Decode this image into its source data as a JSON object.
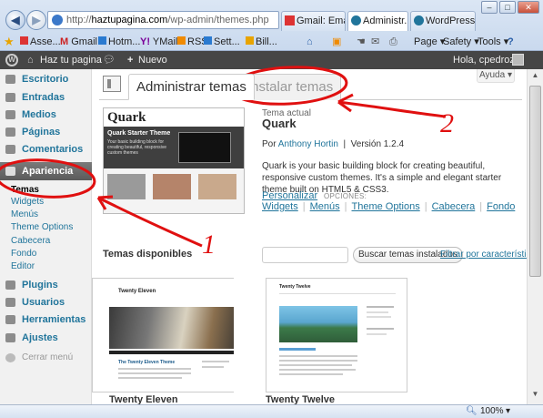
{
  "browser": {
    "url_host": "haztupagina.com",
    "url_prefix": "http://",
    "url_path": "/wp-admin/themes.php",
    "tabs": [
      "Gmail: Email ...",
      "Administr...",
      "WordPress |..."
    ],
    "favorites": [
      "Asse...",
      "Gmail",
      "Hotm...",
      "YMail",
      "RSS",
      "Sett...",
      "Bill..."
    ],
    "command_bar": [
      "Page",
      "Safety",
      "Tools"
    ],
    "zoom": "100%"
  },
  "wp_admin_bar": {
    "site_name": "Haz tu pagina",
    "new_label": "Nuevo",
    "greeting": "Hola, cpedroza"
  },
  "menu": {
    "items": [
      "Escritorio",
      "Entradas",
      "Medios",
      "Páginas",
      "Comentarios",
      "Apariencia"
    ],
    "submenu": [
      "Temas",
      "Widgets",
      "Menús",
      "Theme Options",
      "Cabecera",
      "Fondo",
      "Editor"
    ],
    "items_lower": [
      "Plugins",
      "Usuarios",
      "Herramientas",
      "Ajustes"
    ],
    "collapse": "Cerrar menú"
  },
  "page": {
    "help": "Ayuda",
    "tab_manage": "Administrar temas",
    "tab_install": "Instalar temas"
  },
  "current_theme": {
    "label": "Tema actual",
    "name": "Quark",
    "by": "Por",
    "author": "Anthony Hortin",
    "version": "Versión 1.2.4",
    "description": "Quark is your basic building block for creating beautiful, responsive custom themes. It's a simple and elegant starter theme built on HTML5 & CSS3.",
    "customize": "Personalizar",
    "options_label": "OPCIONES:",
    "options": [
      "Widgets",
      "Menús",
      "Theme Options",
      "Cabecera",
      "Fondo"
    ],
    "screenshot": {
      "logo": "Quark",
      "heading": "Quark Starter Theme",
      "tagline": "Your basic building block for creating beautiful, responsive custom themes"
    }
  },
  "available": {
    "heading": "Temas disponibles",
    "search_button": "Buscar temas instalados",
    "filter_link": "Filtrar por características",
    "themes": [
      {
        "name": "Twenty Eleven",
        "preview_title": "Twenty Eleven",
        "preview_post": "The Twenty Eleven Theme"
      },
      {
        "name": "Twenty Twelve",
        "preview_title": "Twenty Twelve"
      }
    ]
  },
  "annotations": [
    "1",
    "2"
  ],
  "colors": {
    "annotation": "#e01010",
    "link": "#21759b",
    "admin_bar": "#464646"
  }
}
